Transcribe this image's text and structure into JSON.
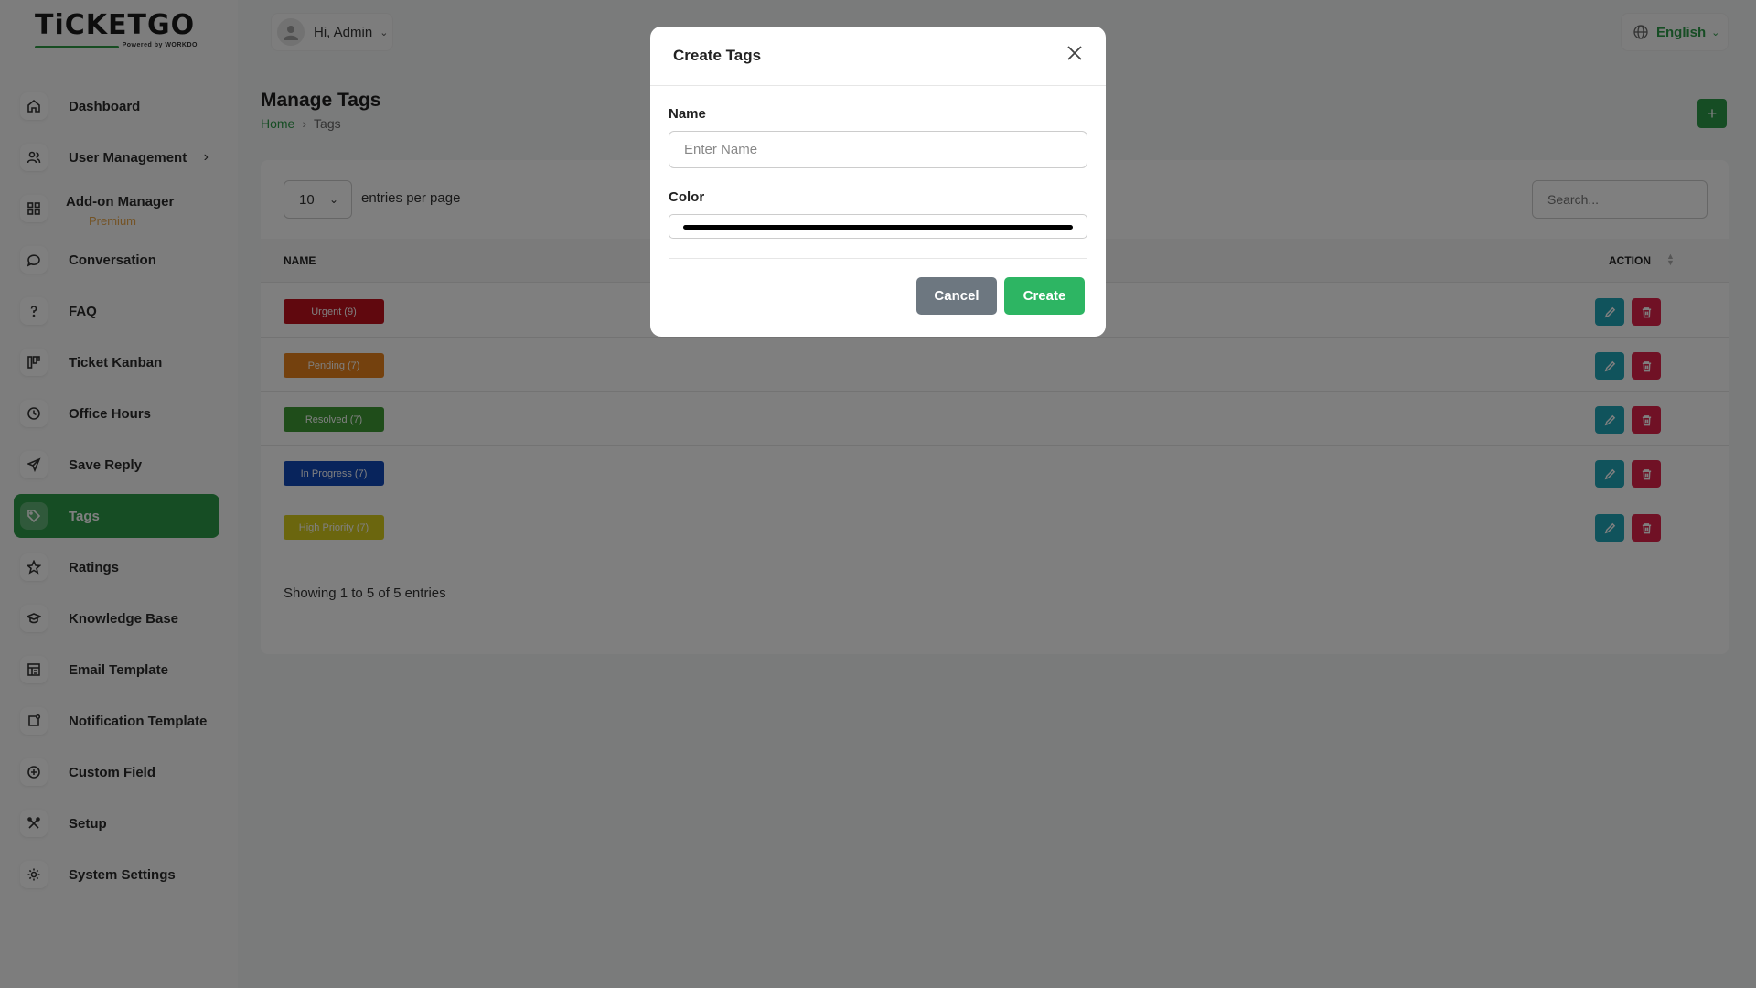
{
  "brand": {
    "name": "TiCKETGO",
    "powered_by": "Powered by WORKDO"
  },
  "header": {
    "greeting": "Hi, Admin",
    "language": "English"
  },
  "sidebar": {
    "items": [
      {
        "label": "Dashboard",
        "icon": "home-icon"
      },
      {
        "label": "User Management",
        "icon": "users-icon"
      },
      {
        "label": "Add-on Manager",
        "sub": "Premium",
        "icon": "grid-icon"
      },
      {
        "label": "Conversation",
        "icon": "chat-icon"
      },
      {
        "label": "FAQ",
        "icon": "question-icon"
      },
      {
        "label": "Ticket Kanban",
        "icon": "kanban-icon"
      },
      {
        "label": "Office Hours",
        "icon": "clock-icon"
      },
      {
        "label": "Save Reply",
        "icon": "send-icon"
      },
      {
        "label": "Tags",
        "icon": "tag-icon"
      },
      {
        "label": "Ratings",
        "icon": "star-icon"
      },
      {
        "label": "Knowledge Base",
        "icon": "graduation-icon"
      },
      {
        "label": "Email Template",
        "icon": "template-icon"
      },
      {
        "label": "Notification Template",
        "icon": "notification-icon"
      },
      {
        "label": "Custom Field",
        "icon": "plus-circle-icon"
      },
      {
        "label": "Setup",
        "icon": "tools-icon"
      },
      {
        "label": "System Settings",
        "icon": "gear-icon"
      }
    ],
    "active": "Tags"
  },
  "page": {
    "title": "Manage Tags",
    "breadcrumb_home": "Home",
    "breadcrumb_current": "Tags",
    "add_label": "+"
  },
  "table": {
    "per_page": "10",
    "per_page_label": "entries per page",
    "search_placeholder": "Search...",
    "col_name": "NAME",
    "col_action": "ACTION",
    "rows": [
      {
        "label": "Urgent (9)",
        "color": "#c0101d"
      },
      {
        "label": "Pending (7)",
        "color": "#e8821c"
      },
      {
        "label": "Resolved (7)",
        "color": "#3e9b35"
      },
      {
        "label": "In Progress (7)",
        "color": "#1148b8"
      },
      {
        "label": "High Priority (7)",
        "color": "#d7cc1d"
      }
    ],
    "showing": "Showing 1 to 5 of 5 entries"
  },
  "modal": {
    "title": "Create Tags",
    "name_label": "Name",
    "name_placeholder": "Enter Name",
    "name_value": "",
    "color_label": "Color",
    "color_value": "#000000",
    "cancel_label": "Cancel",
    "create_label": "Create"
  },
  "colors": {
    "accent": "#2d9a48",
    "edit": "#21a6b8",
    "delete": "#e0224a",
    "create": "#2db563",
    "cancel": "#6d7780"
  }
}
